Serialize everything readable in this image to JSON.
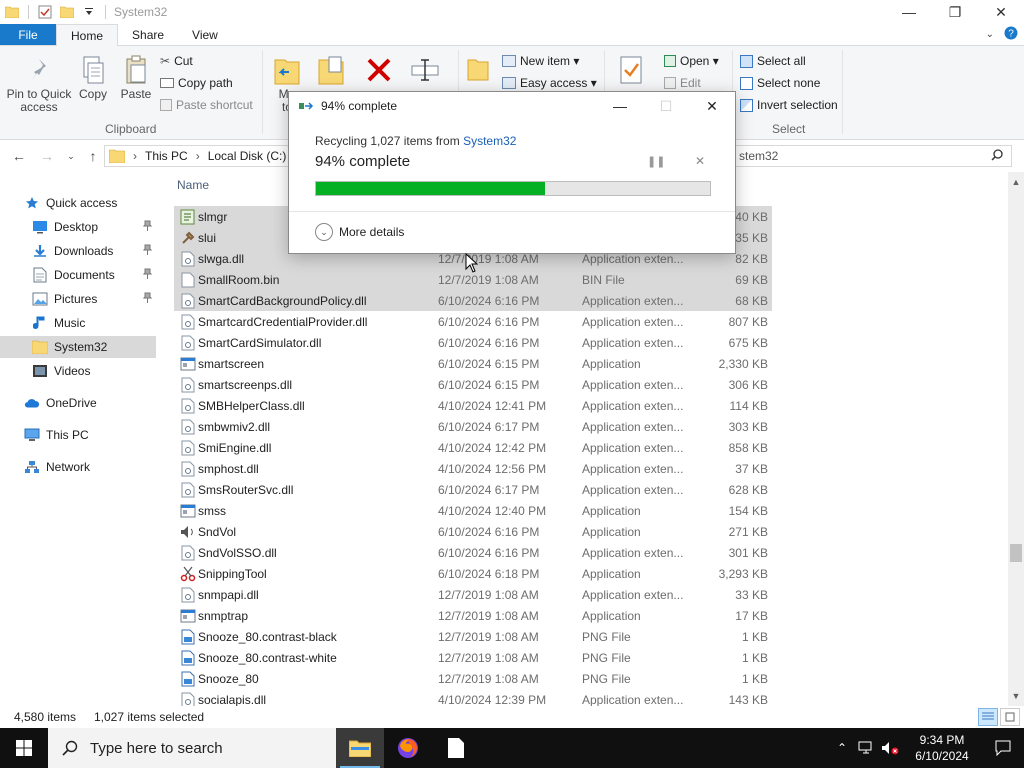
{
  "window": {
    "title": "System32",
    "controls": {
      "minimize": "—",
      "maximize": "❐",
      "close": "✕"
    }
  },
  "tabs": {
    "file": "File",
    "home": "Home",
    "share": "Share",
    "view": "View"
  },
  "ribbon": {
    "clipboard": {
      "pin": "Pin to Quick access",
      "copy": "Copy",
      "paste": "Paste",
      "cut": "Cut",
      "copy_path": "Copy path",
      "paste_shortcut": "Paste shortcut",
      "label": "Clipboard"
    },
    "organize": {
      "move_to": "Mo",
      "move_to_2": "to"
    },
    "new": {
      "new_item": "New item ▾",
      "easy_access": "Easy access ▾"
    },
    "open": {
      "open": "Open ▾",
      "edit": "Edit"
    },
    "select": {
      "select_all": "Select all",
      "select_none": "Select none",
      "invert": "Invert selection",
      "label": "Select"
    }
  },
  "address": {
    "crumbs": [
      "This PC",
      "Local Disk (C:)"
    ],
    "search_text": "stem32"
  },
  "nav": {
    "items": [
      {
        "label": "Quick access",
        "icon": "star-icon",
        "pinned": false
      },
      {
        "label": "Desktop",
        "icon": "desktop-icon",
        "pinned": true
      },
      {
        "label": "Downloads",
        "icon": "download-icon",
        "pinned": true
      },
      {
        "label": "Documents",
        "icon": "documents-icon",
        "pinned": true
      },
      {
        "label": "Pictures",
        "icon": "pictures-icon",
        "pinned": true
      },
      {
        "label": "Music",
        "icon": "music-icon",
        "pinned": false
      },
      {
        "label": "System32",
        "icon": "folder-icon",
        "pinned": false
      },
      {
        "label": "Videos",
        "icon": "videos-icon",
        "pinned": false
      },
      {
        "label": "OneDrive",
        "icon": "cloud-icon",
        "pinned": false
      },
      {
        "label": "This PC",
        "icon": "computer-icon",
        "pinned": false
      },
      {
        "label": "Network",
        "icon": "network-icon",
        "pinned": false
      }
    ]
  },
  "files": {
    "column_name": "Name",
    "rows": [
      {
        "name": "slmgr",
        "date": "",
        "type": "",
        "size": "40 KB",
        "icon": "script-icon",
        "selected": true
      },
      {
        "name": "slui",
        "date": "",
        "type": "",
        "size": "535 KB",
        "icon": "tool-icon",
        "selected": true
      },
      {
        "name": "slwga.dll",
        "date": "12/7/2019 1:08 AM",
        "type": "Application exten...",
        "size": "82 KB",
        "icon": "dll-icon",
        "selected": true
      },
      {
        "name": "SmallRoom.bin",
        "date": "12/7/2019 1:08 AM",
        "type": "BIN File",
        "size": "69 KB",
        "icon": "file-icon",
        "selected": true
      },
      {
        "name": "SmartCardBackgroundPolicy.dll",
        "date": "6/10/2024 6:16 PM",
        "type": "Application exten...",
        "size": "68 KB",
        "icon": "dll-icon",
        "selected": true
      },
      {
        "name": "SmartcardCredentialProvider.dll",
        "date": "6/10/2024 6:16 PM",
        "type": "Application exten...",
        "size": "807 KB",
        "icon": "dll-icon",
        "selected": false
      },
      {
        "name": "SmartCardSimulator.dll",
        "date": "6/10/2024 6:16 PM",
        "type": "Application exten...",
        "size": "675 KB",
        "icon": "dll-icon",
        "selected": false
      },
      {
        "name": "smartscreen",
        "date": "6/10/2024 6:15 PM",
        "type": "Application",
        "size": "2,330 KB",
        "icon": "app-icon",
        "selected": false
      },
      {
        "name": "smartscreenps.dll",
        "date": "6/10/2024 6:15 PM",
        "type": "Application exten...",
        "size": "306 KB",
        "icon": "dll-icon",
        "selected": false
      },
      {
        "name": "SMBHelperClass.dll",
        "date": "4/10/2024 12:41 PM",
        "type": "Application exten...",
        "size": "114 KB",
        "icon": "dll-icon",
        "selected": false
      },
      {
        "name": "smbwmiv2.dll",
        "date": "6/10/2024 6:17 PM",
        "type": "Application exten...",
        "size": "303 KB",
        "icon": "dll-icon",
        "selected": false
      },
      {
        "name": "SmiEngine.dll",
        "date": "4/10/2024 12:42 PM",
        "type": "Application exten...",
        "size": "858 KB",
        "icon": "dll-icon",
        "selected": false
      },
      {
        "name": "smphost.dll",
        "date": "4/10/2024 12:56 PM",
        "type": "Application exten...",
        "size": "37 KB",
        "icon": "dll-icon",
        "selected": false
      },
      {
        "name": "SmsRouterSvc.dll",
        "date": "6/10/2024 6:17 PM",
        "type": "Application exten...",
        "size": "628 KB",
        "icon": "dll-icon",
        "selected": false
      },
      {
        "name": "smss",
        "date": "4/10/2024 12:40 PM",
        "type": "Application",
        "size": "154 KB",
        "icon": "app-icon",
        "selected": false
      },
      {
        "name": "SndVol",
        "date": "6/10/2024 6:16 PM",
        "type": "Application",
        "size": "271 KB",
        "icon": "speaker-icon",
        "selected": false
      },
      {
        "name": "SndVolSSO.dll",
        "date": "6/10/2024 6:16 PM",
        "type": "Application exten...",
        "size": "301 KB",
        "icon": "dll-icon",
        "selected": false
      },
      {
        "name": "SnippingTool",
        "date": "6/10/2024 6:18 PM",
        "type": "Application",
        "size": "3,293 KB",
        "icon": "scissors-icon",
        "selected": false
      },
      {
        "name": "snmpapi.dll",
        "date": "12/7/2019 1:08 AM",
        "type": "Application exten...",
        "size": "33 KB",
        "icon": "dll-icon",
        "selected": false
      },
      {
        "name": "snmptrap",
        "date": "12/7/2019 1:08 AM",
        "type": "Application",
        "size": "17 KB",
        "icon": "app-icon",
        "selected": false
      },
      {
        "name": "Snooze_80.contrast-black",
        "date": "12/7/2019 1:08 AM",
        "type": "PNG File",
        "size": "1 KB",
        "icon": "image-icon",
        "selected": false
      },
      {
        "name": "Snooze_80.contrast-white",
        "date": "12/7/2019 1:08 AM",
        "type": "PNG File",
        "size": "1 KB",
        "icon": "image-icon",
        "selected": false
      },
      {
        "name": "Snooze_80",
        "date": "12/7/2019 1:08 AM",
        "type": "PNG File",
        "size": "1 KB",
        "icon": "image-icon",
        "selected": false
      },
      {
        "name": "socialapis.dll",
        "date": "4/10/2024 12:39 PM",
        "type": "Application exten...",
        "size": "143 KB",
        "icon": "dll-icon",
        "selected": false
      }
    ]
  },
  "status": {
    "items": "4,580 items",
    "selected": "1,027 items selected"
  },
  "dialog": {
    "title": "94% complete",
    "subtitle_prefix": "Recycling 1,027 items from ",
    "subtitle_link": "System32",
    "main": "94% complete",
    "progress": 0.58,
    "more_details": "More details",
    "pause": "❚❚",
    "cancel": "✕"
  },
  "taskbar": {
    "search_placeholder": "Type here to search",
    "time": "9:34 PM",
    "date": "6/10/2024"
  },
  "colors": {
    "accent": "#1979ca",
    "progress": "#06b025",
    "selection": "#d9d9d9"
  }
}
